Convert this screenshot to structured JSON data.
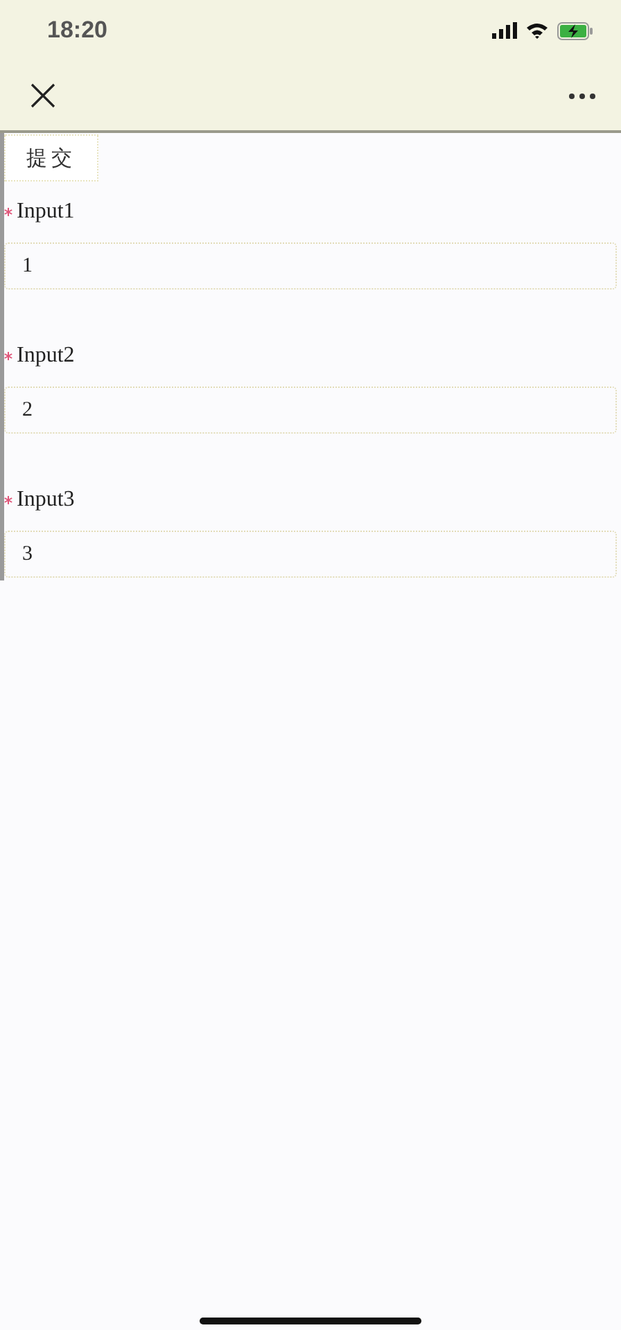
{
  "status_bar": {
    "time": "18:20"
  },
  "submit_button": {
    "label": "提交"
  },
  "fields": [
    {
      "label": "Input1",
      "required": true,
      "value": "1"
    },
    {
      "label": "Input2",
      "required": true,
      "value": "2"
    },
    {
      "label": "Input3",
      "required": true,
      "value": "3"
    }
  ]
}
